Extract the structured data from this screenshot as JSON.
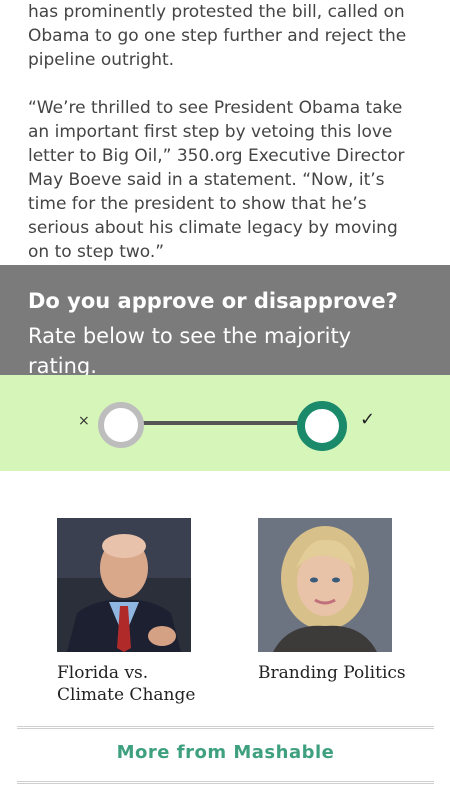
{
  "article": {
    "para1": "has prominently protested the bill, called on Obama to go one step further and reject the pipeline outright.",
    "para2": "“We’re thrilled to see President Obama take an important first step by vetoing this love letter to Big Oil,” 350.org Executive Director May Boeve said in a statement. “Now, it’s time for the president to show that he’s serious about his climate legacy by moving on to step two.”"
  },
  "rating": {
    "title": "Do you approve or disapprove?",
    "subtitle": "Rate below to see the majority rating.",
    "disapprove_symbol": "×",
    "approve_symbol": "✓",
    "selected": "approve"
  },
  "cards": [
    {
      "title": "Florida vs. Climate Change"
    },
    {
      "title": "Branding Politics"
    }
  ],
  "more": {
    "label": "More from Mashable"
  },
  "colors": {
    "header_bg": "#7b7b7b",
    "slider_bg": "#d6f5b9",
    "accent": "#1a8a6b",
    "more_link": "#3fa07f"
  }
}
